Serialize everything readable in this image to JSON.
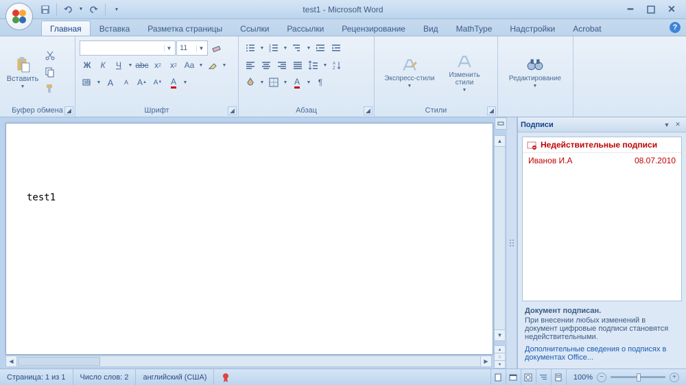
{
  "title": "test1 - Microsoft Word",
  "tabs": [
    "Главная",
    "Вставка",
    "Разметка страницы",
    "Ссылки",
    "Рассылки",
    "Рецензирование",
    "Вид",
    "MathType",
    "Надстройки",
    "Acrobat"
  ],
  "activeTab": 0,
  "ribbon": {
    "clipboard": {
      "label": "Буфер обмена",
      "paste": "Вставить"
    },
    "font": {
      "label": "Шрифт",
      "fontName": "",
      "fontSize": "11"
    },
    "paragraph": {
      "label": "Абзац"
    },
    "styles": {
      "label": "Стили",
      "quick": "Экспресс-стили",
      "change": "Изменить\nстили"
    },
    "editing": {
      "label": "Редактирование"
    }
  },
  "document": {
    "text": "test1"
  },
  "signaturesPane": {
    "title": "Подписи",
    "invalidHeader": "Недействительные подписи",
    "items": [
      {
        "name": "Иванов И.А",
        "date": "08.07.2010"
      }
    ],
    "signedTitle": "Документ подписан.",
    "signedNote": "При внесении любых изменений в документ цифровые подписи становятся недействительными.",
    "moreLink": "Дополнительные сведения о подписях в документах Office..."
  },
  "status": {
    "page": "Страница: 1 из 1",
    "words": "Число слов: 2",
    "language": "английский (США)",
    "zoom": "100%"
  }
}
